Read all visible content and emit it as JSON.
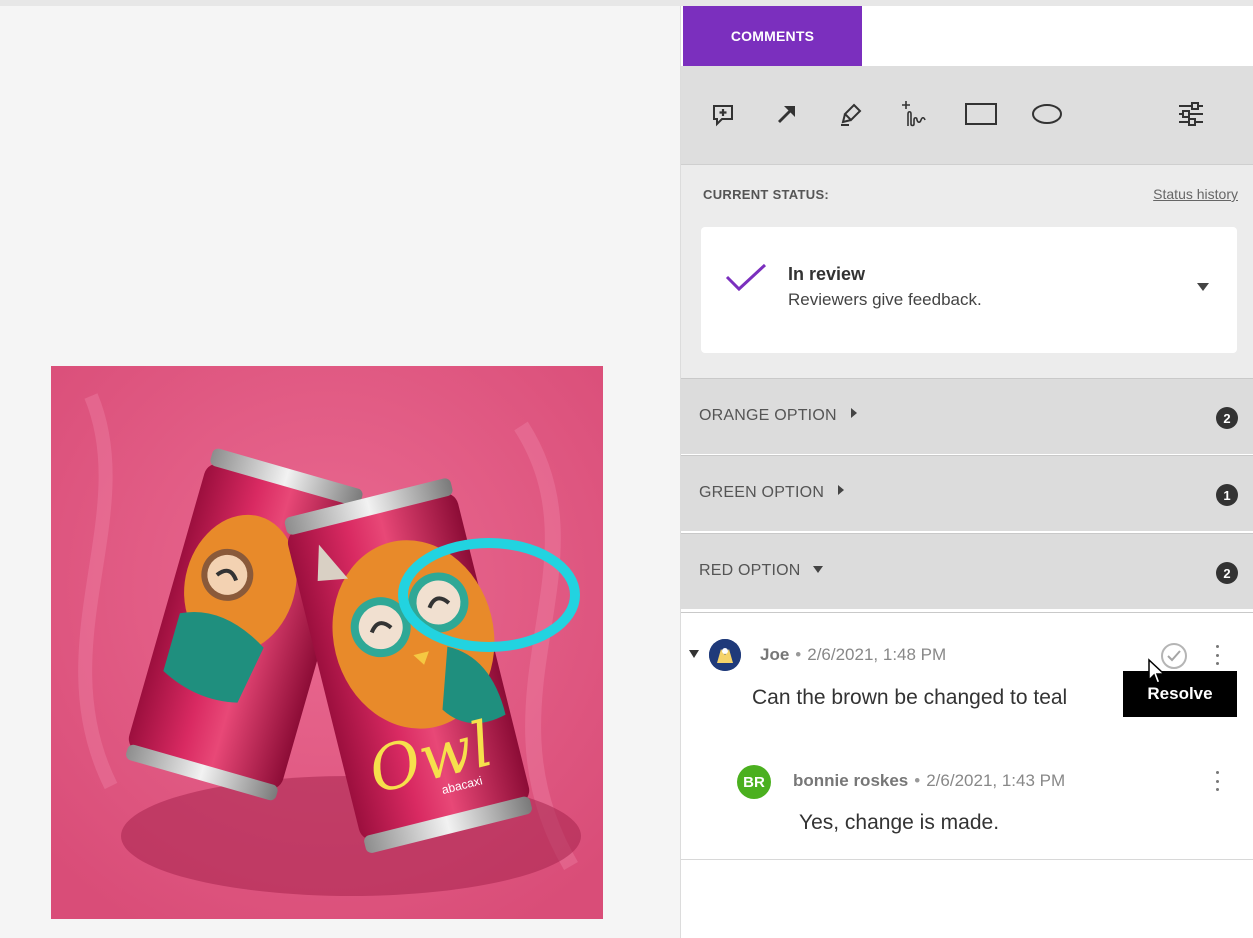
{
  "tabs": {
    "comments": "COMMENTS"
  },
  "toolbar": {
    "tools": [
      "add-comment-icon",
      "arrow-icon",
      "highlighter-icon",
      "freehand-icon",
      "rectangle-icon",
      "ellipse-icon"
    ],
    "settings_icon": "sliders-icon"
  },
  "status": {
    "label": "CURRENT STATUS:",
    "history_link": "Status history",
    "current": "In review",
    "description": "Reviewers give feedback.",
    "check_color": "#7b2fbe"
  },
  "groups": [
    {
      "label": "ORANGE OPTION",
      "count": "2",
      "expanded": false
    },
    {
      "label": "GREEN OPTION",
      "count": "1",
      "expanded": false
    },
    {
      "label": "RED OPTION",
      "count": "2",
      "expanded": true
    }
  ],
  "comments": [
    {
      "author": "Joe",
      "date": "2/6/2021, 1:48 PM",
      "text": "Can the brown be changed to teal"
    },
    {
      "author": "bonnie roskes",
      "initials": "BR",
      "date": "2/6/2021, 1:43 PM",
      "text": "Yes, change is made."
    }
  ],
  "tooltip": {
    "resolve": "Resolve"
  },
  "artwork": {
    "can_logo": "Owl",
    "can_sub": "abacaxi",
    "annotation_color": "#22d3e0",
    "background_color": "#e35a82"
  },
  "colors": {
    "accent": "#7b2fbe",
    "avatar_br": "#4bb01f"
  }
}
